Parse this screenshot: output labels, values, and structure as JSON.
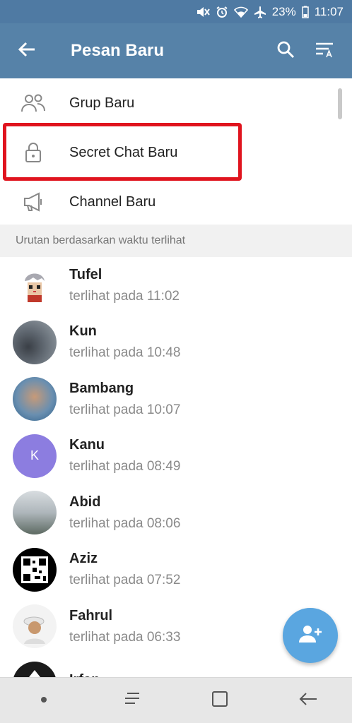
{
  "status_bar": {
    "battery": "23%",
    "time": "11:07",
    "icons": [
      "mute-icon",
      "alarm-icon",
      "wifi-icon",
      "airplane-icon",
      "battery-icon"
    ]
  },
  "app_bar": {
    "title": "Pesan Baru",
    "icons": [
      "back-arrow-icon",
      "search-icon",
      "sort-icon"
    ]
  },
  "menu": {
    "items": [
      {
        "label": "Grup Baru",
        "icon": "group-icon"
      },
      {
        "label": "Secret Chat Baru",
        "icon": "lock-icon",
        "highlighted": true
      },
      {
        "label": "Channel Baru",
        "icon": "megaphone-icon"
      }
    ]
  },
  "section_header": "Urutan berdasarkan waktu terlihat",
  "contacts": [
    {
      "name": "Tufel",
      "status": "terlihat pada  11:02"
    },
    {
      "name": "Kun",
      "status": "terlihat pada  10:48"
    },
    {
      "name": "Bambang",
      "status": "terlihat pada  10:07"
    },
    {
      "name": "Kanu",
      "status": "terlihat pada  08:49",
      "initial": "K",
      "avatar_color": "#8c7de0"
    },
    {
      "name": "Abid",
      "status": "terlihat pada  08:06"
    },
    {
      "name": "Aziz",
      "status": "terlihat pada  07:52"
    },
    {
      "name": "Fahrul",
      "status": "terlihat pada  06:33"
    },
    {
      "name": "Irfan",
      "status": ""
    }
  ],
  "colors": {
    "app_bar": "#5682a8",
    "status_bar": "#4f7aa3",
    "fab": "#5aa6e0",
    "highlight": "#e0141e"
  },
  "fab_icon": "add-contact-icon",
  "nav_bar": {
    "icons": [
      "dot-icon",
      "recents-icon",
      "home-icon",
      "back-icon"
    ]
  }
}
